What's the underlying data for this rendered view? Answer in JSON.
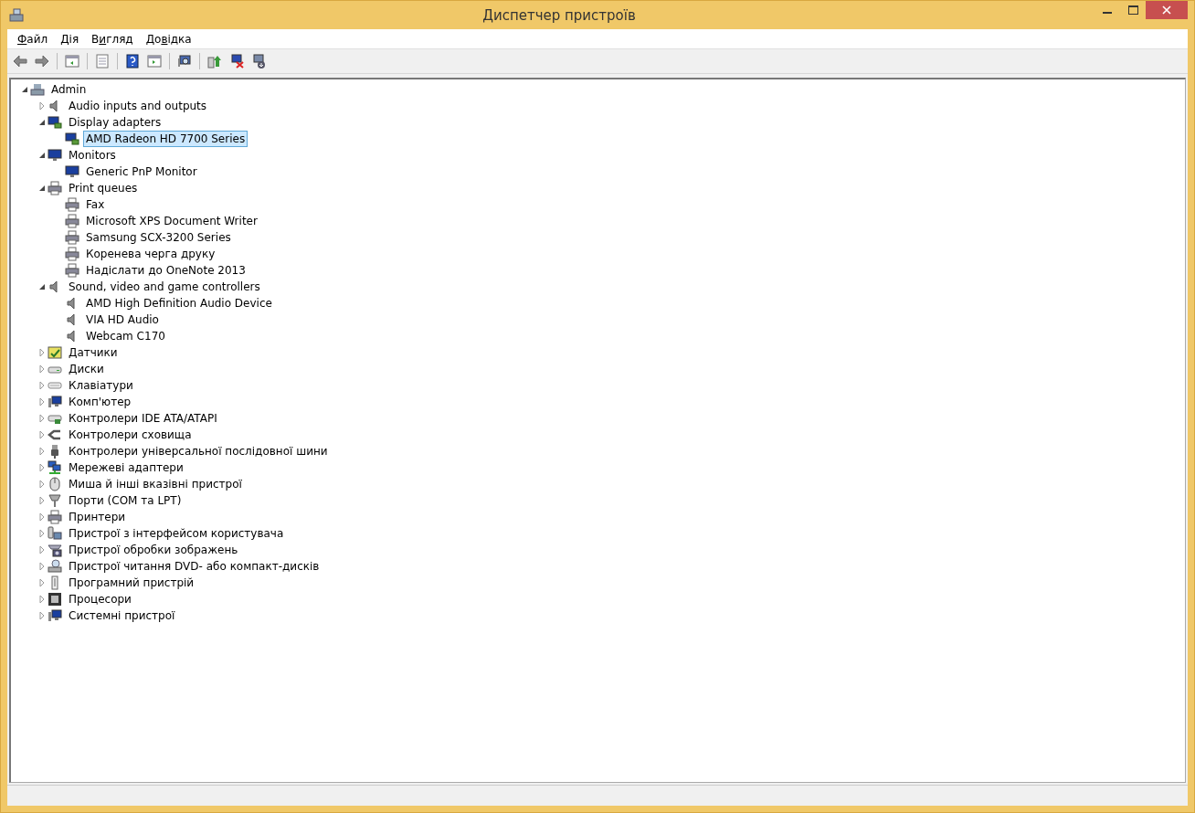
{
  "window": {
    "title": "Диспетчер пристроїв"
  },
  "menu": [
    {
      "mnemonic": "Ф",
      "rest": "айл"
    },
    {
      "mnemonic": "Д",
      "rest": "ія"
    },
    {
      "pre": "В",
      "mnemonic": "и",
      "rest": "гляд"
    },
    {
      "pre": "До",
      "mnemonic": "в",
      "rest": "ідка"
    }
  ],
  "tree": [
    {
      "label": "Admin",
      "kind": "computer",
      "expanded": true,
      "selected": false,
      "children": [
        {
          "label": "Audio inputs and outputs",
          "kind": "audio",
          "expanded": false,
          "selected": false
        },
        {
          "label": "Display adapters",
          "kind": "display",
          "expanded": true,
          "selected": false,
          "children": [
            {
              "label": "AMD Radeon HD 7700 Series",
              "kind": "display",
              "selected": true
            }
          ]
        },
        {
          "label": "Monitors",
          "kind": "monitor",
          "expanded": true,
          "selected": false,
          "children": [
            {
              "label": "Generic PnP Monitor",
              "kind": "monitor",
              "selected": false
            }
          ]
        },
        {
          "label": "Print queues",
          "kind": "printer",
          "expanded": true,
          "selected": false,
          "children": [
            {
              "label": "Fax",
              "kind": "printer",
              "selected": false
            },
            {
              "label": "Microsoft XPS Document Writer",
              "kind": "printer",
              "selected": false
            },
            {
              "label": "Samsung SCX-3200 Series",
              "kind": "printer",
              "selected": false
            },
            {
              "label": "Коренева черга друку",
              "kind": "printer",
              "selected": false
            },
            {
              "label": "Надіслати до OneNote 2013",
              "kind": "printer",
              "selected": false
            }
          ]
        },
        {
          "label": "Sound, video and game controllers",
          "kind": "audio",
          "expanded": true,
          "selected": false,
          "children": [
            {
              "label": "AMD High Definition Audio Device",
              "kind": "audio",
              "selected": false
            },
            {
              "label": "VIA HD Audio",
              "kind": "audio",
              "selected": false
            },
            {
              "label": "Webcam C170",
              "kind": "audio",
              "selected": false
            }
          ]
        },
        {
          "label": "Датчики",
          "kind": "sensor",
          "expanded": false,
          "selected": false
        },
        {
          "label": "Диски",
          "kind": "disk",
          "expanded": false,
          "selected": false
        },
        {
          "label": "Клавіатури",
          "kind": "keyboard",
          "expanded": false,
          "selected": false
        },
        {
          "label": "Комп'ютер",
          "kind": "pc",
          "expanded": false,
          "selected": false
        },
        {
          "label": "Контролери IDE ATA/ATAPI",
          "kind": "ide",
          "expanded": false,
          "selected": false
        },
        {
          "label": "Контролери сховища",
          "kind": "storage",
          "expanded": false,
          "selected": false
        },
        {
          "label": "Контролери універсальної послідовної шини",
          "kind": "usb",
          "expanded": false,
          "selected": false
        },
        {
          "label": "Мережеві адаптери",
          "kind": "network",
          "expanded": false,
          "selected": false
        },
        {
          "label": "Миша й інші вказівні пристрої",
          "kind": "mouse",
          "expanded": false,
          "selected": false
        },
        {
          "label": "Порти (COM та LPT)",
          "kind": "port",
          "expanded": false,
          "selected": false
        },
        {
          "label": "Принтери",
          "kind": "printer",
          "expanded": false,
          "selected": false
        },
        {
          "label": "Пристрої з інтерфейсом користувача",
          "kind": "hid",
          "expanded": false,
          "selected": false
        },
        {
          "label": "Пристрої обробки зображень",
          "kind": "imaging",
          "expanded": false,
          "selected": false
        },
        {
          "label": "Пристрої читання DVD- або компакт-дисків",
          "kind": "dvd",
          "expanded": false,
          "selected": false
        },
        {
          "label": "Програмний пристрій",
          "kind": "software",
          "expanded": false,
          "selected": false
        },
        {
          "label": "Процесори",
          "kind": "cpu",
          "expanded": false,
          "selected": false
        },
        {
          "label": "Системні пристрої",
          "kind": "pc",
          "expanded": false,
          "selected": false
        }
      ]
    }
  ]
}
